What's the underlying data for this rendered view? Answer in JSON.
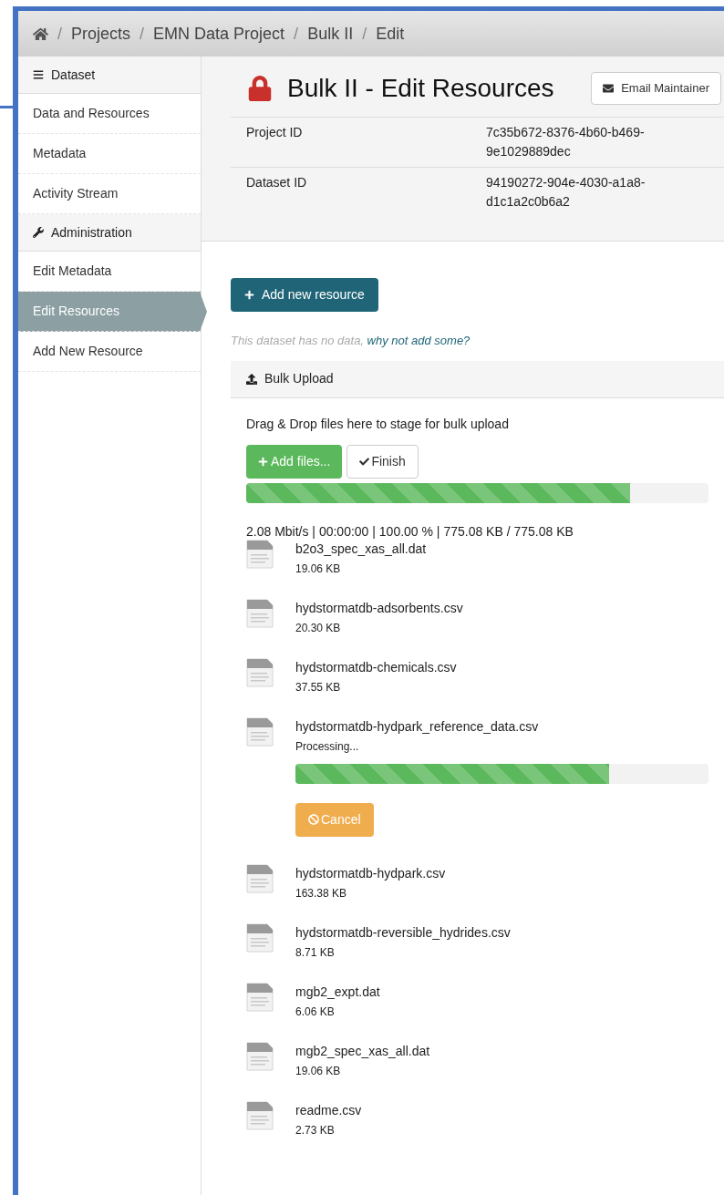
{
  "breadcrumb": [
    {
      "separator": "/",
      "label": "Projects"
    },
    {
      "separator": "/",
      "label": "EMN Data Project"
    },
    {
      "separator": "/",
      "label": "Bulk II"
    },
    {
      "separator": "/",
      "label": "Edit"
    }
  ],
  "sidebar": {
    "sections": [
      {
        "title": "Dataset",
        "items": [
          {
            "label": "Data and Resources",
            "selected": false
          },
          {
            "label": "Metadata",
            "selected": false
          },
          {
            "label": "Activity Stream",
            "selected": false
          }
        ]
      },
      {
        "title": "Administration",
        "items": [
          {
            "label": "Edit Metadata",
            "selected": false
          },
          {
            "label": "Edit Resources",
            "selected": true
          },
          {
            "label": "Add New Resource",
            "selected": false
          }
        ]
      }
    ]
  },
  "header": {
    "title": "Bulk II - Edit Resources",
    "email_button": "Email Maintainer",
    "info": [
      {
        "label": "Project ID",
        "value": "7c35b672-8376-4b60-b469-9e1029889dec"
      },
      {
        "label": "Dataset ID",
        "value": "94190272-904e-4030-a1a8-d1c1a2c0b6a2"
      }
    ]
  },
  "add_resource_button": "Add new resource",
  "empty_note": {
    "text": "This dataset has no data,",
    "link": "why not add some?"
  },
  "bulk_upload": {
    "title": "Bulk Upload",
    "hint": "Drag & Drop files here to stage for bulk upload",
    "add_files_button": "Add files...",
    "finish_button": "Finish",
    "level": 0.83,
    "stats": "2.08 Mbit/s | 00:00:00 | 100.00 % | 775.08 KB / 775.08 KB",
    "files": [
      {
        "kind": "done",
        "name": "b2o3_spec_xas_all.dat",
        "size": "19.06 KB"
      },
      {
        "kind": "done",
        "name": "hydstormatdb-adsorbents.csv",
        "size": "20.30 KB"
      },
      {
        "kind": "done",
        "name": "hydstormatdb-chemicals.csv",
        "size": "37.55 KB"
      },
      {
        "kind": "processing",
        "name": "hydstormatdb-hydpark_reference_data.csv",
        "status": "Processing...",
        "level": 0.76,
        "cancel_button": "Cancel"
      },
      {
        "kind": "done",
        "name": "hydstormatdb-hydpark.csv",
        "size": "163.38 KB"
      },
      {
        "kind": "done",
        "name": "hydstormatdb-reversible_hydrides.csv",
        "size": "8.71 KB"
      },
      {
        "kind": "done",
        "name": "mgb2_expt.dat",
        "size": "6.06 KB"
      },
      {
        "kind": "done",
        "name": "mgb2_spec_xas_all.dat",
        "size": "19.06 KB"
      },
      {
        "kind": "done",
        "name": "readme.csv",
        "size": "2.73 KB"
      }
    ]
  }
}
